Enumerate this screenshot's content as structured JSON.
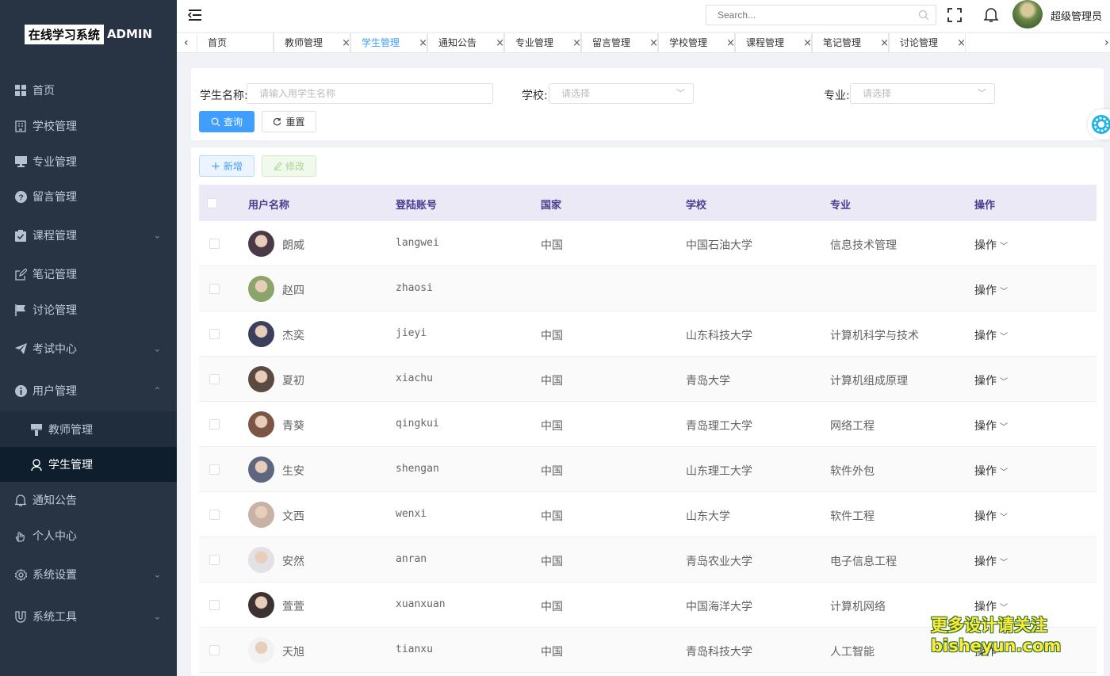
{
  "app": {
    "logo_box": "在线学习系统",
    "logo_suffix": "ADMIN"
  },
  "sidebar": {
    "items": [
      {
        "label": "首页",
        "icon": "grid-icon",
        "arrow": ""
      },
      {
        "label": "学校管理",
        "icon": "building-icon",
        "arrow": ""
      },
      {
        "label": "专业管理",
        "icon": "monitor-icon",
        "arrow": ""
      },
      {
        "label": "留言管理",
        "icon": "question-circle-icon",
        "arrow": ""
      },
      {
        "label": "课程管理",
        "icon": "clipboard-check-icon",
        "arrow": "⌄"
      },
      {
        "label": "笔记管理",
        "icon": "edit-icon",
        "arrow": ""
      },
      {
        "label": "讨论管理",
        "icon": "flag-icon",
        "arrow": ""
      },
      {
        "label": "考试中心",
        "icon": "send-icon",
        "arrow": "⌄"
      },
      {
        "label": "用户管理",
        "icon": "info-circle-icon",
        "arrow": "⌃"
      },
      {
        "label": "教师管理",
        "icon": "brush-icon",
        "arrow": ""
      },
      {
        "label": "学生管理",
        "icon": "user-icon",
        "arrow": ""
      },
      {
        "label": "通知公告",
        "icon": "bell-icon",
        "arrow": ""
      },
      {
        "label": "个人中心",
        "icon": "hand-icon",
        "arrow": ""
      },
      {
        "label": "系统设置",
        "icon": "settings-icon",
        "arrow": "⌄"
      },
      {
        "label": "系统工具",
        "icon": "magnet-icon",
        "arrow": "⌄"
      }
    ]
  },
  "header": {
    "search_placeholder": "Search...",
    "username": "超级管理员"
  },
  "tabs": [
    {
      "label": "首页",
      "closable": false
    },
    {
      "label": "教师管理",
      "closable": true
    },
    {
      "label": "学生管理",
      "closable": true
    },
    {
      "label": "通知公告",
      "closable": true
    },
    {
      "label": "专业管理",
      "closable": true
    },
    {
      "label": "留言管理",
      "closable": true
    },
    {
      "label": "学校管理",
      "closable": true
    },
    {
      "label": "课程管理",
      "closable": true
    },
    {
      "label": "笔记管理",
      "closable": true
    },
    {
      "label": "讨论管理",
      "closable": true
    }
  ],
  "filter": {
    "name_label": "学生名称:",
    "name_placeholder": "请输入用学生名称",
    "school_label": "学校:",
    "school_placeholder": "请选择",
    "major_label": "专业:",
    "major_placeholder": "请选择",
    "query_label": "查询",
    "reset_label": "重置"
  },
  "toolbar": {
    "add_label": "新增",
    "edit_label": "修改"
  },
  "table": {
    "columns": [
      "用户名称",
      "登陆账号",
      "国家",
      "学校",
      "专业",
      "操作"
    ],
    "action_label": "操作",
    "rows": [
      {
        "name": "朗威",
        "account": "langwei",
        "country": "中国",
        "school": "中国石油大学",
        "major": "信息技术管理",
        "avatar_color": "#4a3a48"
      },
      {
        "name": "赵四",
        "account": "zhaosi",
        "country": "",
        "school": "",
        "major": "",
        "avatar_color": "#8aa56a"
      },
      {
        "name": "杰奕",
        "account": "jieyi",
        "country": "中国",
        "school": "山东科技大学",
        "major": "计算机科学与技术",
        "avatar_color": "#3c3f5c"
      },
      {
        "name": "夏初",
        "account": "xiachu",
        "country": "中国",
        "school": "青岛大学",
        "major": "计算机组成原理",
        "avatar_color": "#5a4a42"
      },
      {
        "name": "青葵",
        "account": "qingkui",
        "country": "中国",
        "school": "青岛理工大学",
        "major": "网络工程",
        "avatar_color": "#7a5548"
      },
      {
        "name": "生安",
        "account": "shengan",
        "country": "中国",
        "school": "山东理工大学",
        "major": "软件外包",
        "avatar_color": "#5f6780"
      },
      {
        "name": "文西",
        "account": "wenxi",
        "country": "中国",
        "school": "山东大学",
        "major": "软件工程",
        "avatar_color": "#c7b2a5"
      },
      {
        "name": "安然",
        "account": "anran",
        "country": "中国",
        "school": "青岛农业大学",
        "major": "电子信息工程",
        "avatar_color": "#e3e0e6"
      },
      {
        "name": "萱萱",
        "account": "xuanxuan",
        "country": "中国",
        "school": "中国海洋大学",
        "major": "计算机网络",
        "avatar_color": "#3b3231"
      },
      {
        "name": "天旭",
        "account": "tianxu",
        "country": "中国",
        "school": "青岛科技大学",
        "major": "人工智能",
        "avatar_color": "#f2f2f2"
      }
    ]
  },
  "watermark": {
    "line1": "更多设计请关注",
    "line2": "bisheyun.com"
  }
}
